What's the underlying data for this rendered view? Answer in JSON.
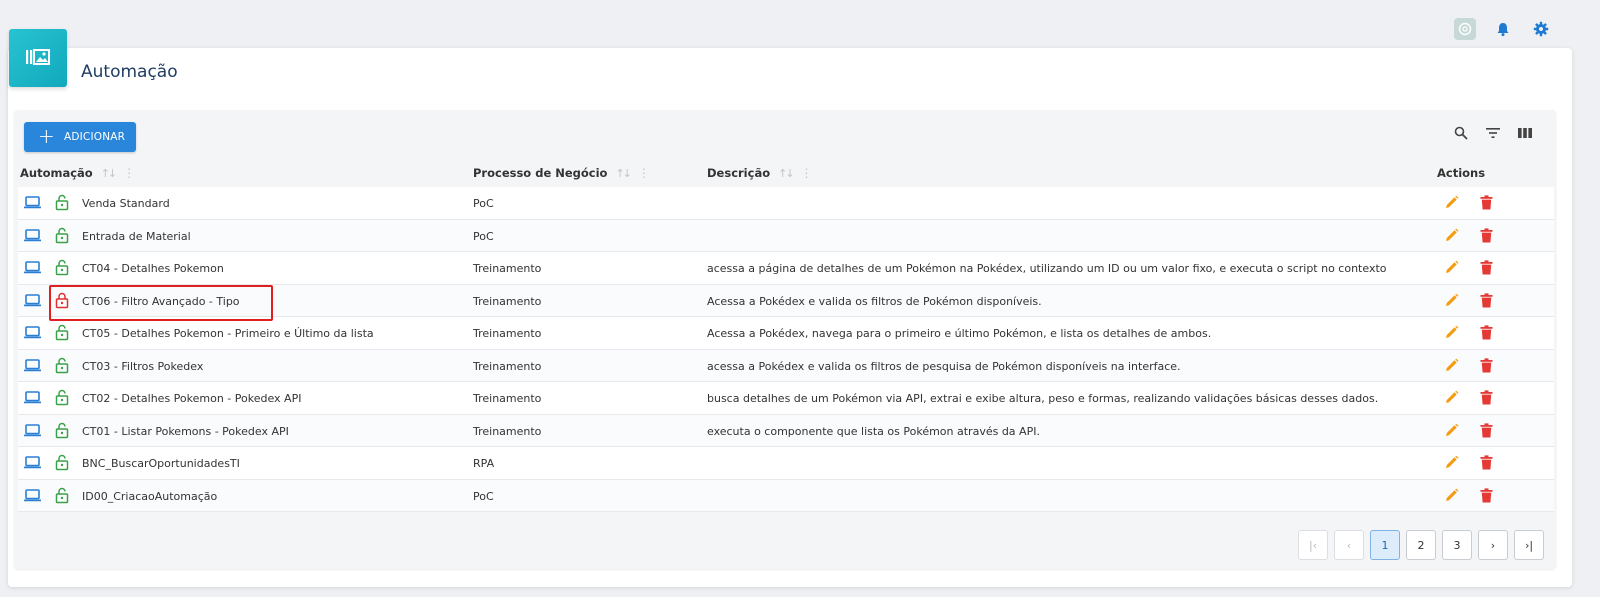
{
  "page": {
    "title": "Automação"
  },
  "toolbar": {
    "add_label": "ADICIONAR"
  },
  "columns": {
    "automacao": "Automação",
    "processo": "Processo de Negócio",
    "descricao": "Descrição",
    "actions": "Actions"
  },
  "rows": [
    {
      "name": "Venda Standard",
      "process": "PoC",
      "description": "",
      "lock": "unlocked"
    },
    {
      "name": "Entrada de Material",
      "process": "PoC",
      "description": "",
      "lock": "unlocked"
    },
    {
      "name": "CT04 - Detalhes Pokemon",
      "process": "Treinamento",
      "description": "acessa a página de detalhes de um Pokémon na Pokédex, utilizando um ID ou um valor fixo, e executa o script no contexto",
      "lock": "unlocked"
    },
    {
      "name": "CT06 - Filtro Avançado - Tipo",
      "process": "Treinamento",
      "description": "Acessa a Pokédex e valida os filtros de Pokémon disponíveis.",
      "lock": "locked"
    },
    {
      "name": "CT05 - Detalhes Pokemon - Primeiro e Último da lista",
      "process": "Treinamento",
      "description": "Acessa a Pokédex, navega para o primeiro e último Pokémon, e lista os detalhes de ambos.",
      "lock": "unlocked"
    },
    {
      "name": "CT03 - Filtros Pokedex",
      "process": "Treinamento",
      "description": "acessa a Pokédex e valida os filtros de pesquisa de Pokémon disponíveis na interface.",
      "lock": "unlocked"
    },
    {
      "name": "CT02 - Detalhes Pokemon - Pokedex API",
      "process": "Treinamento",
      "description": "busca detalhes de um Pokémon via API, extrai e exibe altura, peso e formas, realizando validações básicas desses dados.",
      "lock": "unlocked"
    },
    {
      "name": "CT01 - Listar Pokemons - Pokedex API",
      "process": "Treinamento",
      "description": "executa o componente que lista os Pokémon através da API.",
      "lock": "unlocked"
    },
    {
      "name": "BNC_BuscarOportunidadesTI",
      "process": "RPA",
      "description": "",
      "lock": "unlocked"
    },
    {
      "name": "ID00_CriacaoAutomação",
      "process": "PoC",
      "description": "",
      "lock": "unlocked"
    }
  ],
  "pagination": {
    "pages": [
      "1",
      "2",
      "3"
    ],
    "current": "1"
  },
  "colors": {
    "accent": "#2a86db",
    "unlocked": "#3aa14a",
    "locked": "#e03030",
    "edit": "#f39c12",
    "delete": "#e53935",
    "laptop": "#2a7fd4",
    "highlight": "#e02020"
  }
}
